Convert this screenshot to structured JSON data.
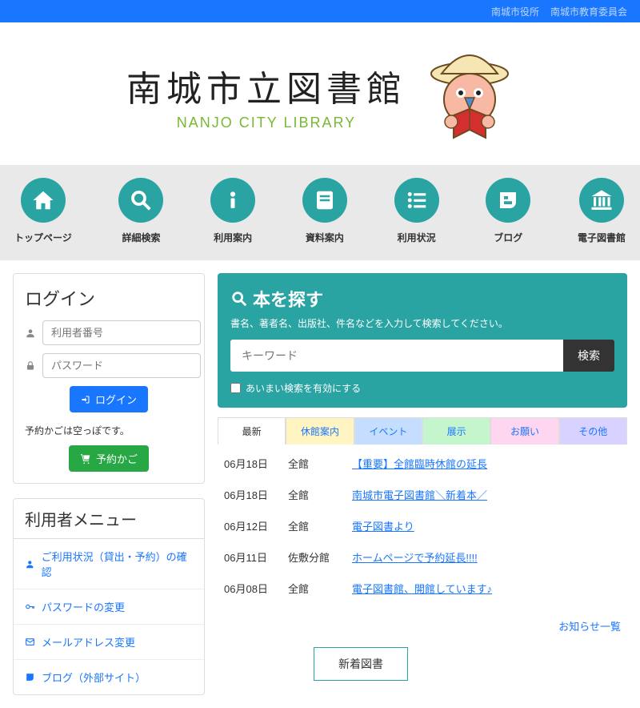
{
  "topbar": {
    "link1": "南城市役所",
    "link2": "南城市教育委員会"
  },
  "logo": {
    "jp": "南城市立図書館",
    "en": "NANJO CITY LIBRARY"
  },
  "nav": [
    {
      "id": "home",
      "label": "トップページ"
    },
    {
      "id": "search",
      "label": "詳細検索"
    },
    {
      "id": "info",
      "label": "利用案内"
    },
    {
      "id": "docs",
      "label": "資料案内"
    },
    {
      "id": "status",
      "label": "利用状況"
    },
    {
      "id": "blog",
      "label": "ブログ"
    },
    {
      "id": "elib",
      "label": "電子図書館"
    }
  ],
  "login": {
    "title": "ログイン",
    "user_placeholder": "利用者番号",
    "pass_placeholder": "パスワード",
    "login_btn": "ログイン",
    "empty": "予約かごは空っぽです。",
    "cart_btn": "予約かご"
  },
  "user_menu": {
    "title": "利用者メニュー",
    "items": [
      "ご利用状況（貸出・予約）の確認",
      "パスワードの変更",
      "メールアドレス変更",
      "ブログ（外部サイト）"
    ]
  },
  "search": {
    "title": "本を探す",
    "desc": "書名、著者名、出版社、件名などを入力して検索してください。",
    "placeholder": "キーワード",
    "btn": "検索",
    "fuzzy": "あいまい検索を有効にする"
  },
  "tabs": [
    "最新",
    "休館案内",
    "イベント",
    "展示",
    "お願い",
    "その他"
  ],
  "news": [
    {
      "date": "06月18日",
      "place": "全館",
      "title": "【重要】全館臨時休館の延長"
    },
    {
      "date": "06月18日",
      "place": "全館",
      "title": "南城市電子図書館＼新着本／"
    },
    {
      "date": "06月12日",
      "place": "全館",
      "title": "電子図書より"
    },
    {
      "date": "06月11日",
      "place": "佐敷分館",
      "title": "ホームページで予約延長!!!!"
    },
    {
      "date": "06月08日",
      "place": "全館",
      "title": "電子図書館、開館しています♪"
    }
  ],
  "news_more": "お知らせ一覧",
  "new_books_label": "新着図書"
}
